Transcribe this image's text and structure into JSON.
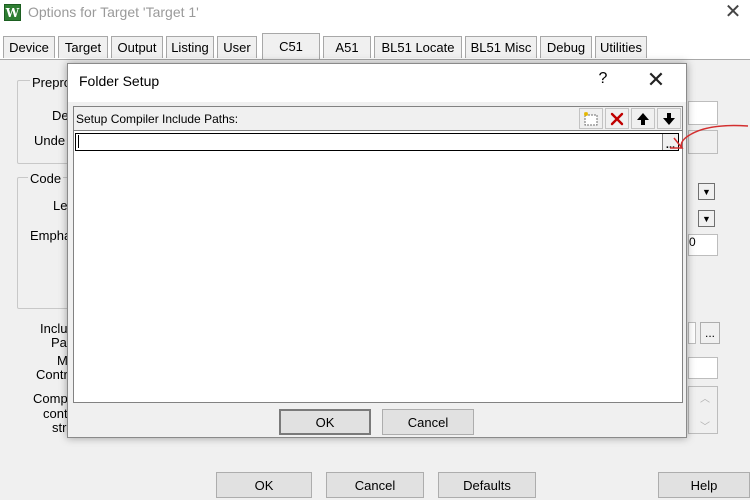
{
  "window": {
    "title": "Options for Target 'Target 1'",
    "icon_letter": "W",
    "close_glyph": "✕"
  },
  "tabs": [
    {
      "label": "Device"
    },
    {
      "label": "Target"
    },
    {
      "label": "Output"
    },
    {
      "label": "Listing"
    },
    {
      "label": "User"
    },
    {
      "label": "C51",
      "active": true
    },
    {
      "label": "A51"
    },
    {
      "label": "BL51 Locate"
    },
    {
      "label": "BL51 Misc"
    },
    {
      "label": "Debug"
    },
    {
      "label": "Utilities"
    }
  ],
  "background": {
    "group_preproc": "Prepro",
    "label_de": "De",
    "label_unde": "Unde",
    "group_code": "Code",
    "label_le": "Le",
    "label_empha": "Empha",
    "field_value_0": "0",
    "label_inclu": "Inclu",
    "label_pat": "Pat",
    "label_m": "M",
    "label_contr": "Contr",
    "label_comp": "Comp",
    "label_cont": "cont",
    "label_str": "stri",
    "browse_dots": "..."
  },
  "bottom_buttons": {
    "ok": "OK",
    "cancel": "Cancel",
    "defaults": "Defaults",
    "help": "Help"
  },
  "folder_dialog": {
    "title": "Folder Setup",
    "help_glyph": "?",
    "close_glyph": "✕",
    "list_label": "Setup Compiler Include Paths:",
    "path_value": "",
    "browse_label": "...",
    "ok": "OK",
    "cancel": "Cancel"
  },
  "colors": {
    "dialog_bg": "#f0f0f0",
    "delete_icon": "#c00000",
    "new_icon_accent": "#e6b800",
    "annotation": "#d32f2f"
  }
}
